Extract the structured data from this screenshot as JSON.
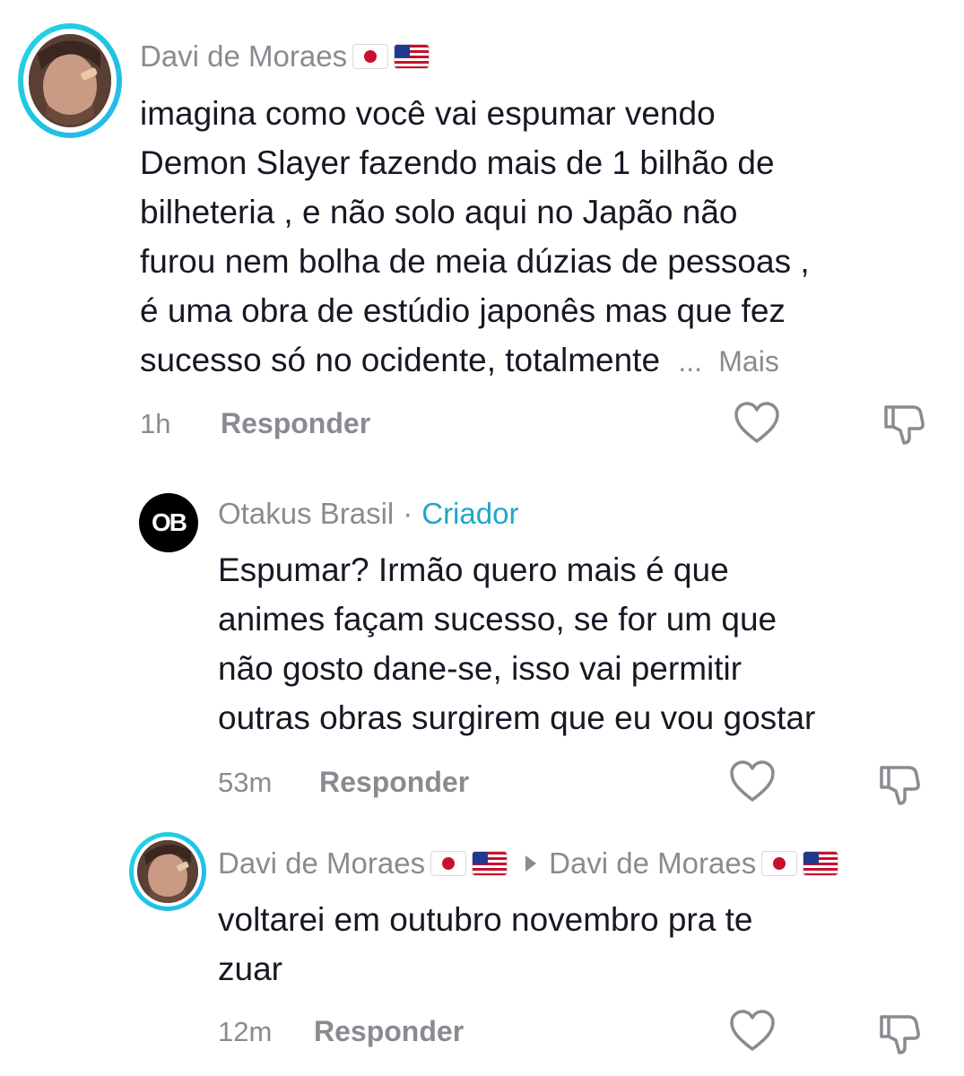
{
  "comments": [
    {
      "author": "Davi de Moraes",
      "flags": [
        "jp-flag",
        "us-flag"
      ],
      "lines": [
        "imagina como você vai espumar vendo",
        "Demon Slayer fazendo mais de 1 bilhão de",
        "bilheteria , e não solo aqui no Japão não",
        "furou nem bolha de meia dúzias de pessoas ,",
        "é uma obra de estúdio japonês mas que fez",
        "sucesso só no ocidente, totalmente"
      ],
      "ellipsis": "...",
      "more_label": "Mais",
      "time": "1h",
      "reply_label": "Responder"
    },
    {
      "author": "Otakus Brasil",
      "separator": "·",
      "badge": "Criador",
      "avatar_text": "OB",
      "lines": [
        "Espumar? Irmão quero mais é que",
        "animes façam sucesso, se for um que",
        "não gosto dane-se, isso vai permitir",
        "outras obras surgirem que eu vou gostar"
      ],
      "time": "53m",
      "reply_label": "Responder"
    },
    {
      "author": "Davi de Moraes",
      "reply_to": "Davi de Moraes",
      "flags": [
        "jp-flag",
        "us-flag"
      ],
      "lines": [
        "voltarei em outubro novembro pra te",
        "zuar"
      ],
      "time": "12m",
      "reply_label": "Responder"
    }
  ],
  "icons": {
    "like": "heart-icon",
    "dislike": "thumbs-down-icon"
  },
  "colors": {
    "text": "#161823",
    "secondary": "#8a8b91",
    "creator": "#20a6c8",
    "ring": "#25d6e6"
  }
}
